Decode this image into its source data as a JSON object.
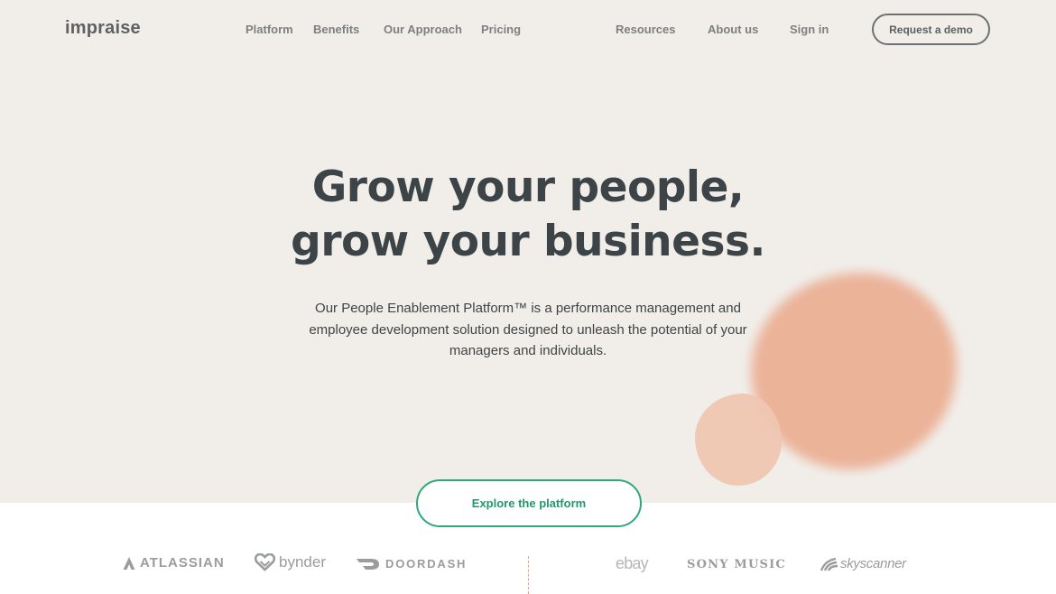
{
  "header": {
    "logo": "impraise",
    "nav": {
      "platform": "Platform",
      "benefits": "Benefits",
      "approach": "Our Approach",
      "pricing": "Pricing",
      "resources": "Resources",
      "about": "About us",
      "signin": "Sign in"
    },
    "demo_button": "Request a demo"
  },
  "hero": {
    "headline_line1": "Grow your people,",
    "headline_line2": "grow your business.",
    "subtext": "Our People Enablement Platform™ is a performance management and employee development solution designed to unleash the potential of your managers and individuals.",
    "cta": "Explore the platform"
  },
  "brands": {
    "atlassian": "ATLASSIAN",
    "bynder": "bynder",
    "doordash": "DOORDASH",
    "ebay": "ebay",
    "sony": "SONY MUSIC",
    "skyscanner": "skyscanner"
  },
  "colors": {
    "hero_bg": "#f1eeea",
    "accent_green": "#2ea87a",
    "blob_peach": "#ebae92"
  }
}
